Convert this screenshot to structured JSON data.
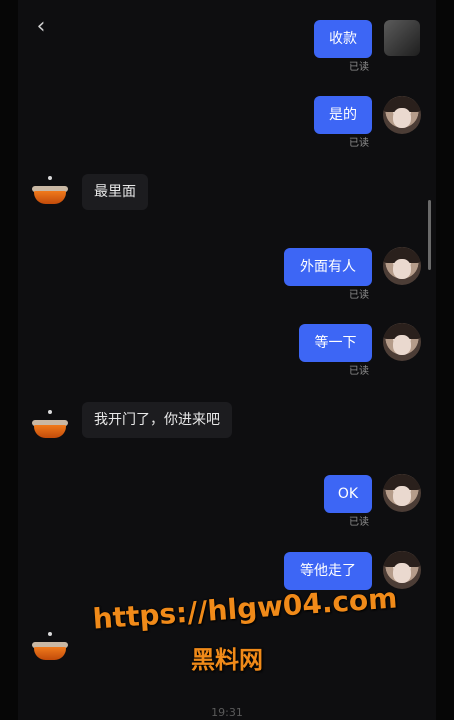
{
  "nav": {
    "back_icon": "chevron-left-icon",
    "back_glyph": "‹"
  },
  "read_label": "已读",
  "messages": [
    {
      "side": "me",
      "text": "收款"
    },
    {
      "side": "me",
      "text": "是的"
    },
    {
      "side": "other",
      "text": "最里面"
    },
    {
      "side": "me",
      "text": "外面有人"
    },
    {
      "side": "me",
      "text": "等一下"
    },
    {
      "side": "other",
      "text": "我开门了，你进来吧"
    },
    {
      "side": "me",
      "text": "OK"
    },
    {
      "side": "me",
      "text": "等他走了"
    }
  ],
  "watermark": {
    "url": "https://hlgw04.com",
    "name": "黑料网"
  },
  "timestamp": "19:31",
  "colors": {
    "outgoing_bubble": "#3d66f5",
    "incoming_bubble": "#1c1c1f",
    "watermark": "#f08a19",
    "background": "#0e0e10"
  }
}
